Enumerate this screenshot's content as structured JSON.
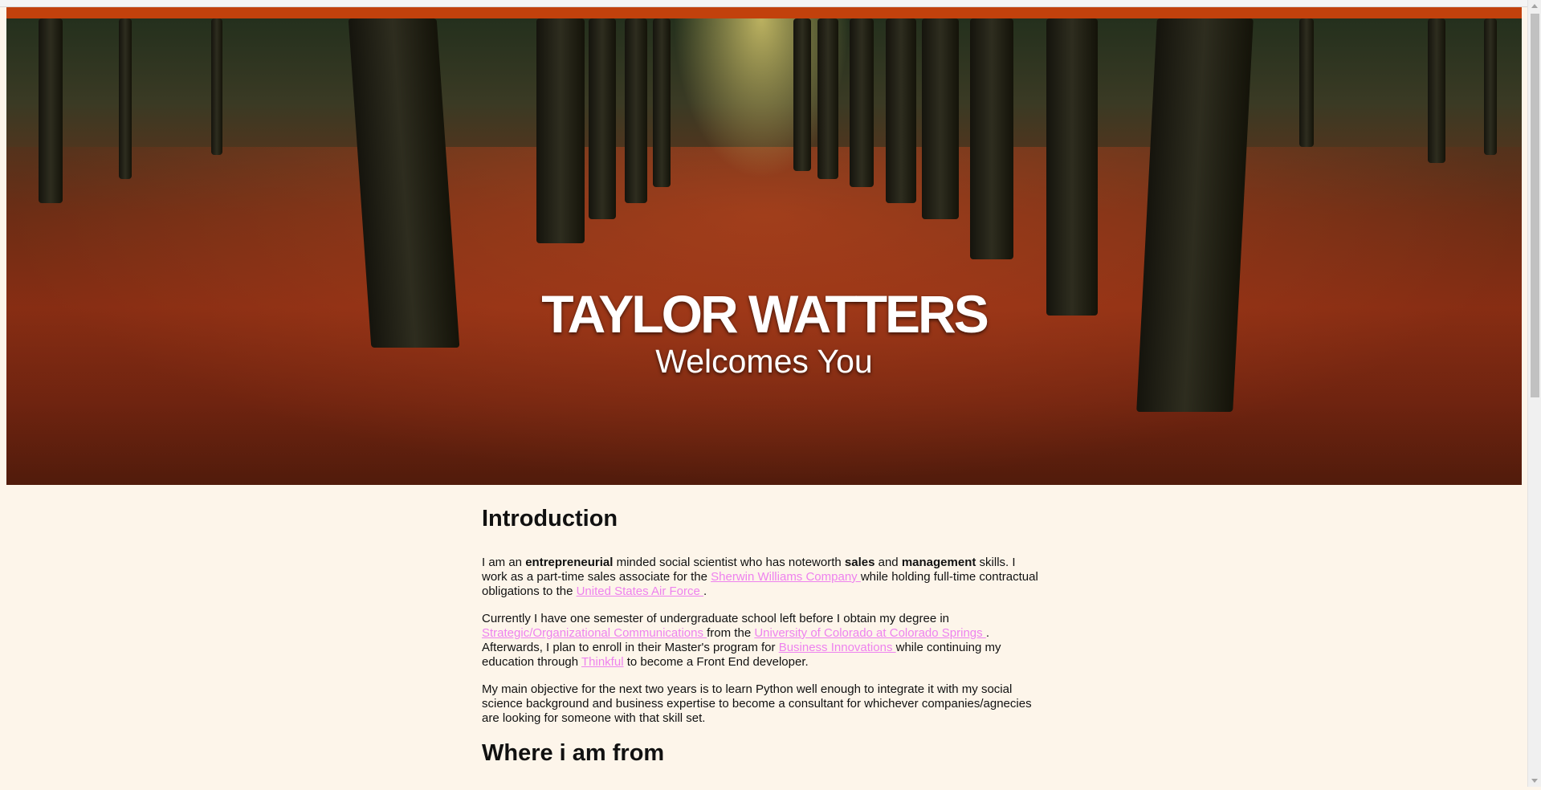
{
  "hero": {
    "title": "TAYLOR WATTERS",
    "subtitle": "Welcomes You",
    "image": "autumn forest path with red leaves"
  },
  "colors": {
    "accent_bar": "#c2410c",
    "background": "#fdf5ea",
    "link": "#ee82ee"
  },
  "intro": {
    "heading": "Introduction",
    "p1": {
      "t1": "I am an ",
      "b1": "entrepreneurial",
      "t2": " minded social scientist who has noteworth ",
      "b2": "sales",
      "t3": " and ",
      "b3": "management",
      "t4": " skills. I work as a part-time sales associate for the ",
      "link1": "Sherwin Williams Company ",
      "t5": " while holding full-time contractual obligations to the ",
      "link2": "United States Air Force ",
      "t6": "."
    },
    "p2": {
      "t1": "Currently I have one semester of undergraduate school left before I obtain my degree in ",
      "link1": "Strategic/Organizational Communications ",
      "t2": " from the ",
      "link2": "University of Colorado at Colorado Springs ",
      "t3": ". Afterwards, I plan to enroll in their Master's program for ",
      "link3": "Business Innovations ",
      "t4": " while continuing my education through ",
      "link4": "Thinkful",
      "t5": " to become a Front End developer."
    },
    "p3": "My main objective for the next two years is to learn Python well enough to integrate it with my social science background and business expertise to become a consultant for whichever companies/agnecies are looking for someone with that skill set."
  },
  "from": {
    "heading": "Where i am from"
  }
}
